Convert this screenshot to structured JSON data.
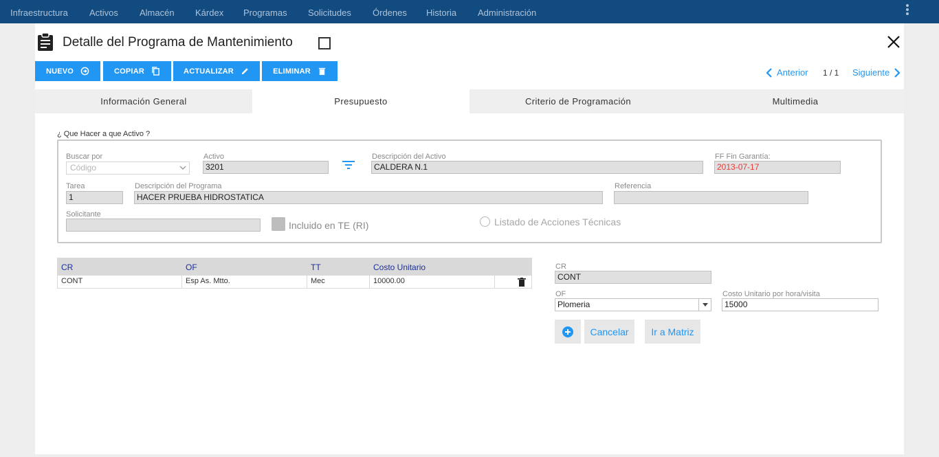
{
  "nav": {
    "items": [
      "Infraestructura",
      "Activos",
      "Almacén",
      "Kárdex",
      "Programas",
      "Solicitudes",
      "Órdenes",
      "Historia",
      "Administración"
    ]
  },
  "header": {
    "title": "Detalle del Programa de Mantenimiento",
    "icon": "clipboard-icon"
  },
  "toolbar": {
    "new_label": "NUEVO",
    "copy_label": "COPIAR",
    "update_label": "ACTUALIZAR",
    "delete_label": "ELIMINAR"
  },
  "pager": {
    "prev_label": "Anterior",
    "count": "1 / 1",
    "next_label": "Siguiente"
  },
  "tabs": [
    "Información General",
    "Presupuesto",
    "Criterio de Programación",
    "Multimedia"
  ],
  "active_tab": "Presupuesto",
  "form": {
    "section_label": "¿ Que Hacer a que Activo ?",
    "buscar_por": {
      "label": "Buscar por",
      "placeholder": "Código"
    },
    "activo": {
      "label": "Activo",
      "value": "3201"
    },
    "descripcion_activo": {
      "label": "Descripción del Activo",
      "value": "CALDERA N.1"
    },
    "ff_fin_garantia": {
      "label": "FF Fin Garantía:",
      "value": "2013-07-17"
    },
    "tarea": {
      "label": "Tarea",
      "value": "1"
    },
    "descripcion_programa": {
      "label": "Descripción del Programa",
      "value": "HACER PRUEBA HIDROSTATICA"
    },
    "referencia": {
      "label": "Referencia",
      "value": ""
    },
    "solicitante": {
      "label": "Solicitante",
      "value": ""
    },
    "incluido_label": "Incluido en TE (RI)",
    "listado_label": "Listado de Acciones Técnicas"
  },
  "grid": {
    "headers": [
      "CR",
      "OF",
      "TT",
      "Costo Unitario"
    ],
    "rows": [
      {
        "cr": "CONT",
        "of": "Esp As. Mtto.",
        "tt": "Mec",
        "costo": "10000.00"
      }
    ]
  },
  "detail": {
    "cr_label": "CR",
    "cr_value": "CONT",
    "of_label": "OF",
    "of_value": "Plomeria",
    "costo_label": "Costo Unitario por hora/visita",
    "costo_value": "15000",
    "cancel_label": "Cancelar",
    "matrix_label": "Ir a Matriz"
  },
  "colors": {
    "nav_bg": "#124b80",
    "accent": "#2196f3",
    "warranty_text": "#e53935",
    "grid_header_text": "#1a2d9c"
  }
}
